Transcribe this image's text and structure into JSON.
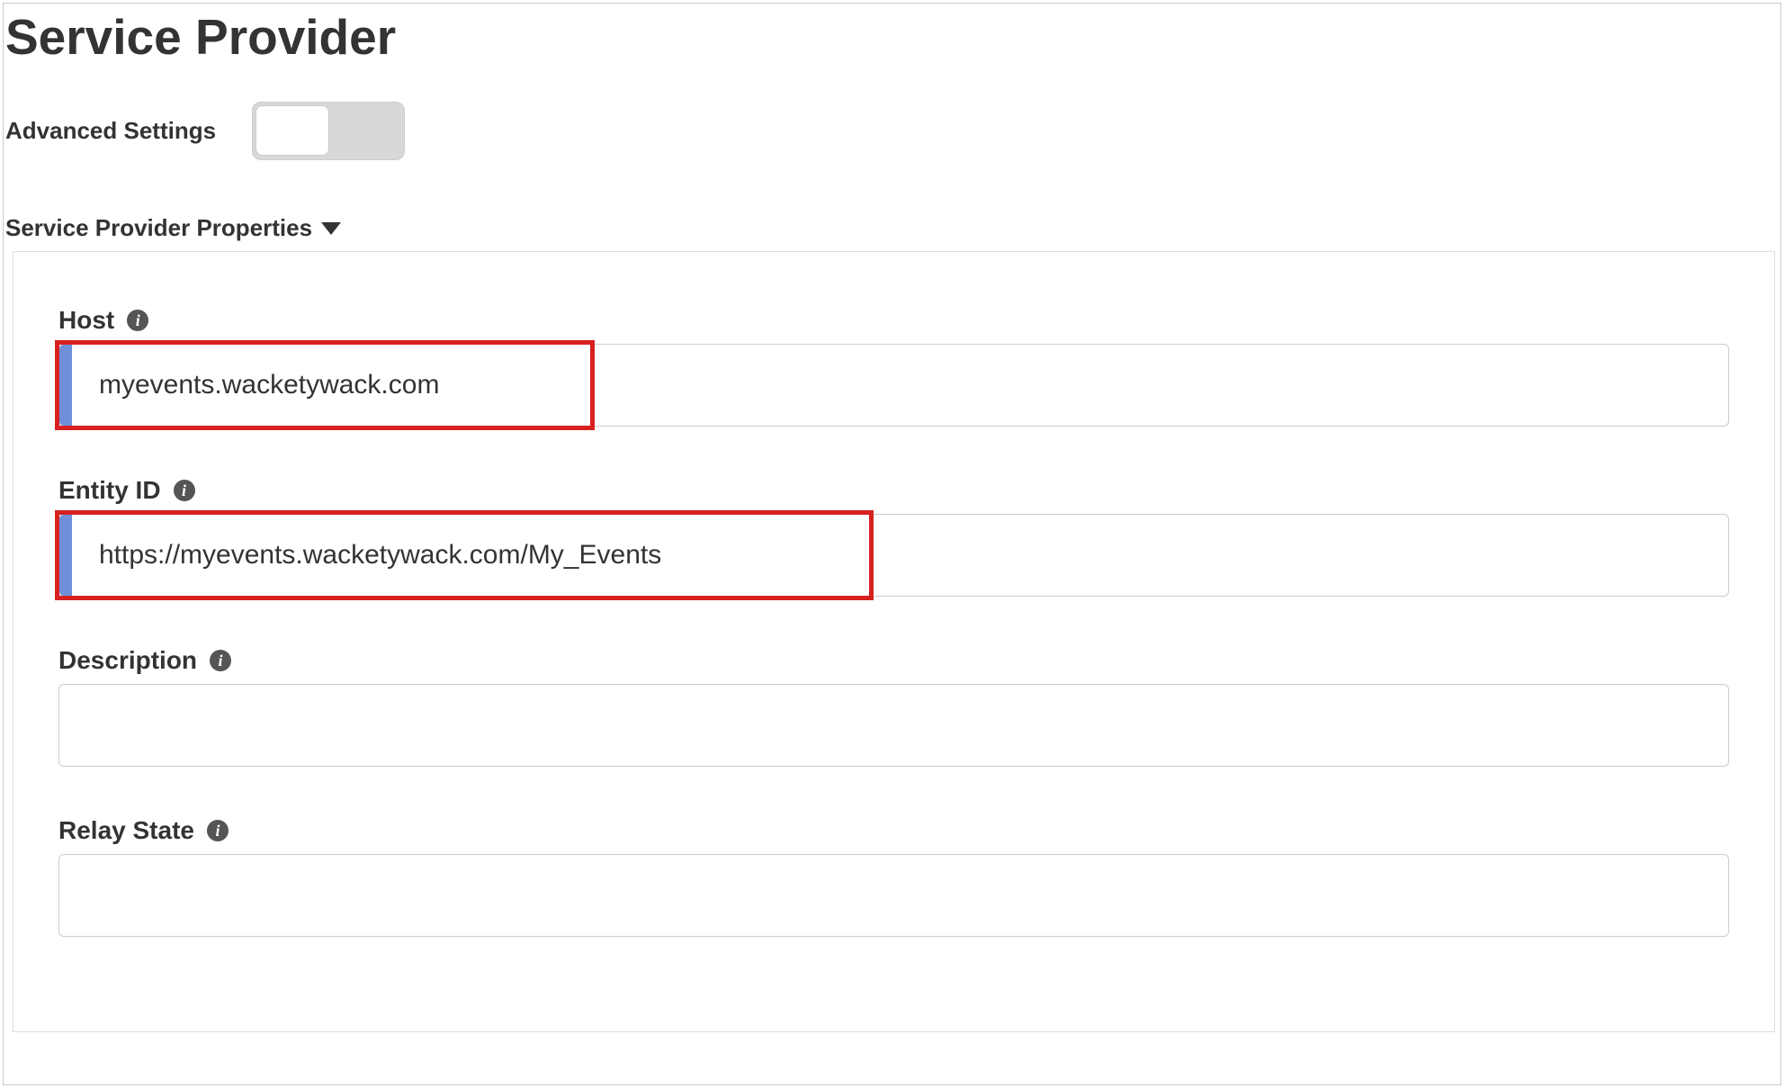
{
  "page": {
    "title": "Service Provider"
  },
  "advanced": {
    "label": "Advanced Settings",
    "enabled": false
  },
  "section": {
    "title": "Service Provider Properties"
  },
  "fields": {
    "host": {
      "label": "Host",
      "value": "myevents.wacketywack.com"
    },
    "entityId": {
      "label": "Entity ID",
      "value": "https://myevents.wacketywack.com/My_Events"
    },
    "description": {
      "label": "Description",
      "value": ""
    },
    "relayState": {
      "label": "Relay State",
      "value": ""
    }
  }
}
